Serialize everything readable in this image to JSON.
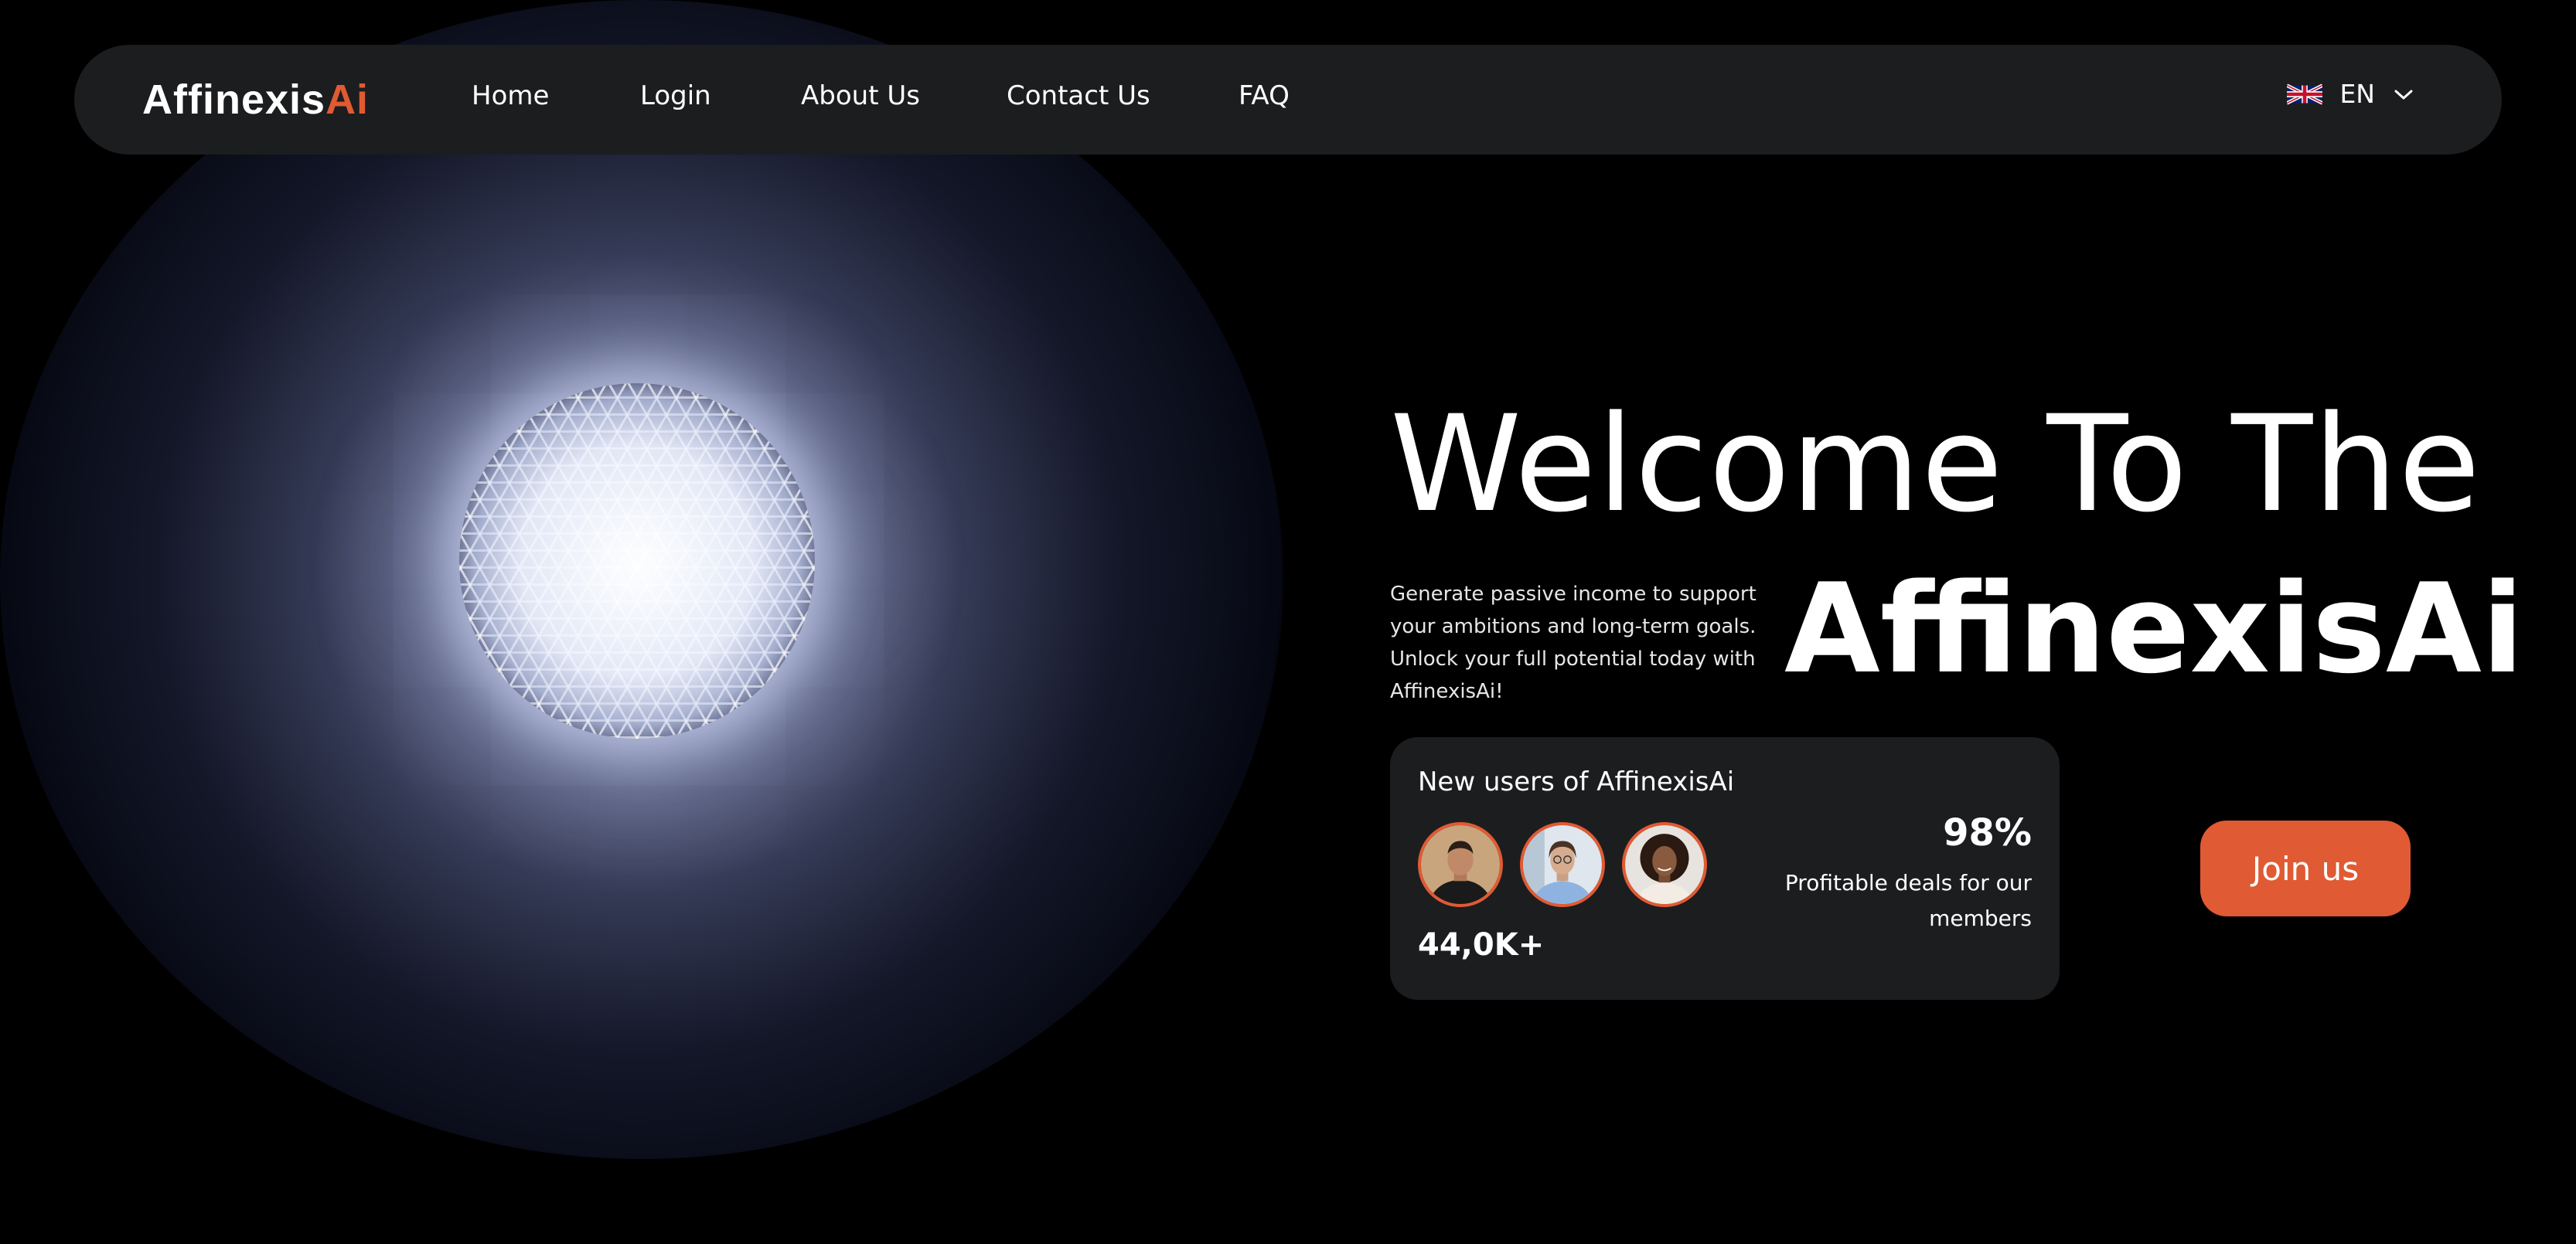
{
  "brand": {
    "name_main": "Affinexis",
    "name_accent": "Ai"
  },
  "nav": {
    "items": [
      {
        "label": "Home"
      },
      {
        "label": "Login"
      },
      {
        "label": "About Us"
      },
      {
        "label": "Contact Us"
      },
      {
        "label": "FAQ"
      }
    ],
    "language": {
      "code": "EN",
      "flag_icon": "uk-flag-icon"
    }
  },
  "hero": {
    "title_line1": "Welcome To The",
    "title_line2": "AffinexisAi",
    "description": "Generate passive income to support your ambitions and long-term goals. Unlock your full potential today with AffinexisAi!"
  },
  "stats_card": {
    "title": "New users of AffinexisAi",
    "user_count": "44,0K+",
    "percentage": "98%",
    "percentage_label": "Profitable deals for our members",
    "avatars": [
      "avatar-man",
      "avatar-woman-glasses",
      "avatar-woman-curly"
    ]
  },
  "cta": {
    "label": "Join us"
  },
  "colors": {
    "accent": "#e05a33",
    "panel": "#1c1d1f",
    "background": "#000000"
  }
}
